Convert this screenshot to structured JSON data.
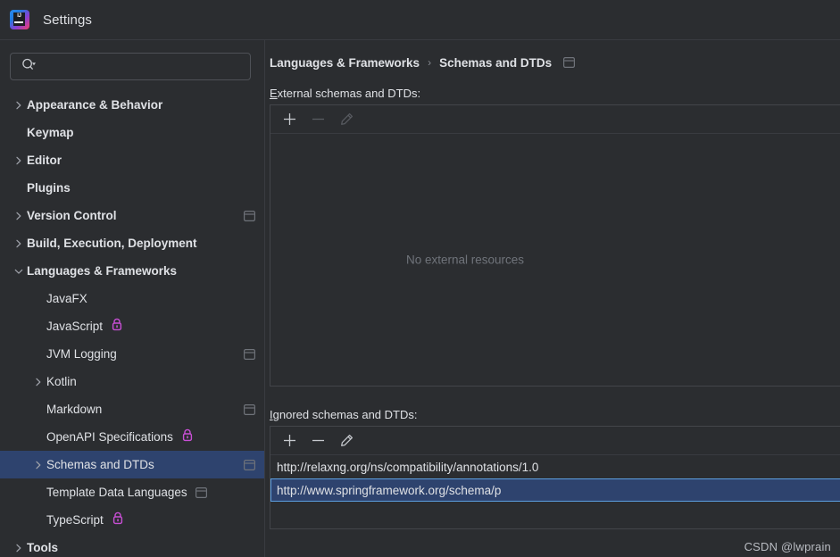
{
  "window": {
    "title": "Settings",
    "logo_icon": "intellij-idea-logo",
    "logo_text": "IJ"
  },
  "search": {
    "placeholder": "",
    "value": "",
    "icon": "search-icon",
    "dropdown_icon": "chevron-down-icon"
  },
  "sidebar": {
    "items": [
      {
        "label": "Appearance & Behavior",
        "level": 0,
        "bold": true,
        "expandable": true,
        "expanded": false,
        "selected": false,
        "lock": false,
        "project_icon": false
      },
      {
        "label": "Keymap",
        "level": 0,
        "bold": true,
        "expandable": false,
        "expanded": false,
        "selected": false,
        "lock": false,
        "project_icon": false
      },
      {
        "label": "Editor",
        "level": 0,
        "bold": true,
        "expandable": true,
        "expanded": false,
        "selected": false,
        "lock": false,
        "project_icon": false
      },
      {
        "label": "Plugins",
        "level": 0,
        "bold": true,
        "expandable": false,
        "expanded": false,
        "selected": false,
        "lock": false,
        "project_icon": false
      },
      {
        "label": "Version Control",
        "level": 0,
        "bold": true,
        "expandable": true,
        "expanded": false,
        "selected": false,
        "lock": false,
        "project_icon": true
      },
      {
        "label": "Build, Execution, Deployment",
        "level": 0,
        "bold": true,
        "expandable": true,
        "expanded": false,
        "selected": false,
        "lock": false,
        "project_icon": false
      },
      {
        "label": "Languages & Frameworks",
        "level": 0,
        "bold": true,
        "expandable": true,
        "expanded": true,
        "selected": false,
        "lock": false,
        "project_icon": false
      },
      {
        "label": "JavaFX",
        "level": 1,
        "bold": false,
        "expandable": false,
        "expanded": false,
        "selected": false,
        "lock": false,
        "project_icon": false
      },
      {
        "label": "JavaScript",
        "level": 1,
        "bold": false,
        "expandable": false,
        "expanded": false,
        "selected": false,
        "lock": true,
        "project_icon": false
      },
      {
        "label": "JVM Logging",
        "level": 1,
        "bold": false,
        "expandable": false,
        "expanded": false,
        "selected": false,
        "lock": false,
        "project_icon": true
      },
      {
        "label": "Kotlin",
        "level": 1,
        "bold": false,
        "expandable": true,
        "expanded": false,
        "selected": false,
        "lock": false,
        "project_icon": false
      },
      {
        "label": "Markdown",
        "level": 1,
        "bold": false,
        "expandable": false,
        "expanded": false,
        "selected": false,
        "lock": false,
        "project_icon": true
      },
      {
        "label": "OpenAPI Specifications",
        "level": 1,
        "bold": false,
        "expandable": false,
        "expanded": false,
        "selected": false,
        "lock": true,
        "project_icon": false
      },
      {
        "label": "Schemas and DTDs",
        "level": 1,
        "bold": false,
        "expandable": true,
        "expanded": false,
        "selected": true,
        "lock": false,
        "project_icon": true
      },
      {
        "label": "Template Data Languages",
        "level": 1,
        "bold": false,
        "expandable": false,
        "expanded": false,
        "selected": false,
        "lock": false,
        "project_icon": true,
        "project_icon_inline": true
      },
      {
        "label": "TypeScript",
        "level": 1,
        "bold": false,
        "expandable": false,
        "expanded": false,
        "selected": false,
        "lock": true,
        "project_icon": false
      },
      {
        "label": "Tools",
        "level": 0,
        "bold": true,
        "expandable": true,
        "expanded": false,
        "selected": false,
        "lock": false,
        "project_icon": false
      }
    ]
  },
  "content": {
    "breadcrumb": {
      "parent": "Languages & Frameworks",
      "separator": "›",
      "current": "Schemas and DTDs",
      "scope_icon": "project-scope-icon"
    },
    "external": {
      "label_mnemonic": "E",
      "label_rest": "xternal schemas and DTDs:",
      "toolbar": [
        {
          "name": "add-button",
          "icon": "plus-icon",
          "enabled": true
        },
        {
          "name": "remove-button",
          "icon": "minus-icon",
          "enabled": false
        },
        {
          "name": "edit-button",
          "icon": "pencil-icon",
          "enabled": false
        }
      ],
      "empty_message": "No external resources",
      "rows": []
    },
    "ignored": {
      "label_mnemonic": "I",
      "label_rest": "gnored schemas and DTDs:",
      "toolbar": [
        {
          "name": "add-button",
          "icon": "plus-icon",
          "enabled": true
        },
        {
          "name": "remove-button",
          "icon": "minus-icon",
          "enabled": true
        },
        {
          "name": "edit-button",
          "icon": "pencil-icon",
          "enabled": true
        }
      ],
      "rows": [
        {
          "value": "http://relaxng.org/ns/compatibility/annotations/1.0",
          "selected": false
        },
        {
          "value": "http://www.springframework.org/schema/p",
          "selected": true
        }
      ]
    }
  },
  "watermark": {
    "text": "CSDN @lwprain"
  },
  "colors": {
    "background": "#2B2D30",
    "selection": "#2E436E",
    "focus_border": "#5C9FE0",
    "lock_accent": "#C94FD6",
    "text": "#DFE1E5",
    "muted_text": "#6F737A",
    "border": "#43454A"
  }
}
